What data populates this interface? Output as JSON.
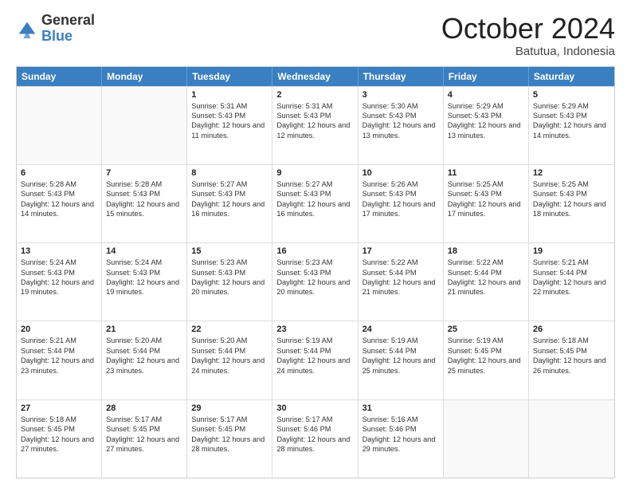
{
  "logo": {
    "general": "General",
    "blue": "Blue"
  },
  "title": "October 2024",
  "location": "Batutua, Indonesia",
  "days": [
    "Sunday",
    "Monday",
    "Tuesday",
    "Wednesday",
    "Thursday",
    "Friday",
    "Saturday"
  ],
  "weeks": [
    [
      {
        "day": "",
        "sunrise": "",
        "sunset": "",
        "daylight": "",
        "empty": true
      },
      {
        "day": "",
        "sunrise": "",
        "sunset": "",
        "daylight": "",
        "empty": true
      },
      {
        "day": "1",
        "sunrise": "Sunrise: 5:31 AM",
        "sunset": "Sunset: 5:43 PM",
        "daylight": "Daylight: 12 hours and 11 minutes.",
        "empty": false
      },
      {
        "day": "2",
        "sunrise": "Sunrise: 5:31 AM",
        "sunset": "Sunset: 5:43 PM",
        "daylight": "Daylight: 12 hours and 12 minutes.",
        "empty": false
      },
      {
        "day": "3",
        "sunrise": "Sunrise: 5:30 AM",
        "sunset": "Sunset: 5:43 PM",
        "daylight": "Daylight: 12 hours and 13 minutes.",
        "empty": false
      },
      {
        "day": "4",
        "sunrise": "Sunrise: 5:29 AM",
        "sunset": "Sunset: 5:43 PM",
        "daylight": "Daylight: 12 hours and 13 minutes.",
        "empty": false
      },
      {
        "day": "5",
        "sunrise": "Sunrise: 5:29 AM",
        "sunset": "Sunset: 5:43 PM",
        "daylight": "Daylight: 12 hours and 14 minutes.",
        "empty": false
      }
    ],
    [
      {
        "day": "6",
        "sunrise": "Sunrise: 5:28 AM",
        "sunset": "Sunset: 5:43 PM",
        "daylight": "Daylight: 12 hours and 14 minutes.",
        "empty": false
      },
      {
        "day": "7",
        "sunrise": "Sunrise: 5:28 AM",
        "sunset": "Sunset: 5:43 PM",
        "daylight": "Daylight: 12 hours and 15 minutes.",
        "empty": false
      },
      {
        "day": "8",
        "sunrise": "Sunrise: 5:27 AM",
        "sunset": "Sunset: 5:43 PM",
        "daylight": "Daylight: 12 hours and 16 minutes.",
        "empty": false
      },
      {
        "day": "9",
        "sunrise": "Sunrise: 5:27 AM",
        "sunset": "Sunset: 5:43 PM",
        "daylight": "Daylight: 12 hours and 16 minutes.",
        "empty": false
      },
      {
        "day": "10",
        "sunrise": "Sunrise: 5:26 AM",
        "sunset": "Sunset: 5:43 PM",
        "daylight": "Daylight: 12 hours and 17 minutes.",
        "empty": false
      },
      {
        "day": "11",
        "sunrise": "Sunrise: 5:25 AM",
        "sunset": "Sunset: 5:43 PM",
        "daylight": "Daylight: 12 hours and 17 minutes.",
        "empty": false
      },
      {
        "day": "12",
        "sunrise": "Sunrise: 5:25 AM",
        "sunset": "Sunset: 5:43 PM",
        "daylight": "Daylight: 12 hours and 18 minutes.",
        "empty": false
      }
    ],
    [
      {
        "day": "13",
        "sunrise": "Sunrise: 5:24 AM",
        "sunset": "Sunset: 5:43 PM",
        "daylight": "Daylight: 12 hours and 19 minutes.",
        "empty": false
      },
      {
        "day": "14",
        "sunrise": "Sunrise: 5:24 AM",
        "sunset": "Sunset: 5:43 PM",
        "daylight": "Daylight: 12 hours and 19 minutes.",
        "empty": false
      },
      {
        "day": "15",
        "sunrise": "Sunrise: 5:23 AM",
        "sunset": "Sunset: 5:43 PM",
        "daylight": "Daylight: 12 hours and 20 minutes.",
        "empty": false
      },
      {
        "day": "16",
        "sunrise": "Sunrise: 5:23 AM",
        "sunset": "Sunset: 5:43 PM",
        "daylight": "Daylight: 12 hours and 20 minutes.",
        "empty": false
      },
      {
        "day": "17",
        "sunrise": "Sunrise: 5:22 AM",
        "sunset": "Sunset: 5:44 PM",
        "daylight": "Daylight: 12 hours and 21 minutes.",
        "empty": false
      },
      {
        "day": "18",
        "sunrise": "Sunrise: 5:22 AM",
        "sunset": "Sunset: 5:44 PM",
        "daylight": "Daylight: 12 hours and 21 minutes.",
        "empty": false
      },
      {
        "day": "19",
        "sunrise": "Sunrise: 5:21 AM",
        "sunset": "Sunset: 5:44 PM",
        "daylight": "Daylight: 12 hours and 22 minutes.",
        "empty": false
      }
    ],
    [
      {
        "day": "20",
        "sunrise": "Sunrise: 5:21 AM",
        "sunset": "Sunset: 5:44 PM",
        "daylight": "Daylight: 12 hours and 23 minutes.",
        "empty": false
      },
      {
        "day": "21",
        "sunrise": "Sunrise: 5:20 AM",
        "sunset": "Sunset: 5:44 PM",
        "daylight": "Daylight: 12 hours and 23 minutes.",
        "empty": false
      },
      {
        "day": "22",
        "sunrise": "Sunrise: 5:20 AM",
        "sunset": "Sunset: 5:44 PM",
        "daylight": "Daylight: 12 hours and 24 minutes.",
        "empty": false
      },
      {
        "day": "23",
        "sunrise": "Sunrise: 5:19 AM",
        "sunset": "Sunset: 5:44 PM",
        "daylight": "Daylight: 12 hours and 24 minutes.",
        "empty": false
      },
      {
        "day": "24",
        "sunrise": "Sunrise: 5:19 AM",
        "sunset": "Sunset: 5:44 PM",
        "daylight": "Daylight: 12 hours and 25 minutes.",
        "empty": false
      },
      {
        "day": "25",
        "sunrise": "Sunrise: 5:19 AM",
        "sunset": "Sunset: 5:45 PM",
        "daylight": "Daylight: 12 hours and 25 minutes.",
        "empty": false
      },
      {
        "day": "26",
        "sunrise": "Sunrise: 5:18 AM",
        "sunset": "Sunset: 5:45 PM",
        "daylight": "Daylight: 12 hours and 26 minutes.",
        "empty": false
      }
    ],
    [
      {
        "day": "27",
        "sunrise": "Sunrise: 5:18 AM",
        "sunset": "Sunset: 5:45 PM",
        "daylight": "Daylight: 12 hours and 27 minutes.",
        "empty": false
      },
      {
        "day": "28",
        "sunrise": "Sunrise: 5:17 AM",
        "sunset": "Sunset: 5:45 PM",
        "daylight": "Daylight: 12 hours and 27 minutes.",
        "empty": false
      },
      {
        "day": "29",
        "sunrise": "Sunrise: 5:17 AM",
        "sunset": "Sunset: 5:45 PM",
        "daylight": "Daylight: 12 hours and 28 minutes.",
        "empty": false
      },
      {
        "day": "30",
        "sunrise": "Sunrise: 5:17 AM",
        "sunset": "Sunset: 5:46 PM",
        "daylight": "Daylight: 12 hours and 28 minutes.",
        "empty": false
      },
      {
        "day": "31",
        "sunrise": "Sunrise: 5:16 AM",
        "sunset": "Sunset: 5:46 PM",
        "daylight": "Daylight: 12 hours and 29 minutes.",
        "empty": false
      },
      {
        "day": "",
        "sunrise": "",
        "sunset": "",
        "daylight": "",
        "empty": true
      },
      {
        "day": "",
        "sunrise": "",
        "sunset": "",
        "daylight": "",
        "empty": true
      }
    ]
  ]
}
